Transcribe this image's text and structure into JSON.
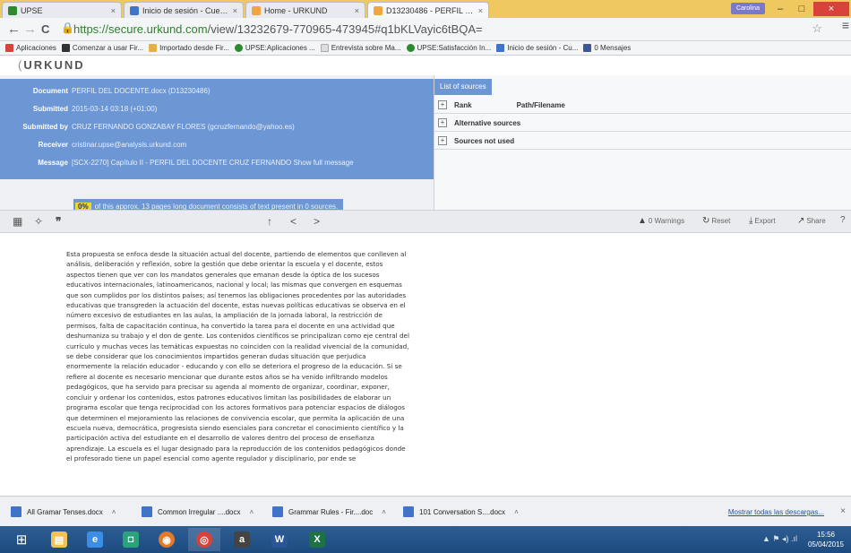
{
  "browser": {
    "tabs": [
      {
        "label": "UPSE",
        "active": false
      },
      {
        "label": "Inicio de sesión - Cuentas",
        "active": false
      },
      {
        "label": "Home - URKUND",
        "active": false
      },
      {
        "label": "D13230486 - PERFIL DEL",
        "active": true
      }
    ],
    "user_badge": "Carolina",
    "minimize": "–",
    "maximize": "□",
    "close": "×",
    "url_host": "https://secure.urkund.com",
    "url_path": "/view/13232679-770965-473945#q1bKLVayic6tBQA=",
    "back": "←",
    "forward": "→",
    "reload": "C",
    "star": "☆",
    "menu": "≡",
    "bookmarks": [
      {
        "label": "Aplicaciones",
        "color": "#d6453d"
      },
      {
        "label": "Comenzar a usar Fir...",
        "color": "#333333"
      },
      {
        "label": "Importado desde Fir...",
        "color": "#e2b24a"
      },
      {
        "label": "UPSE:Aplicaciones ...",
        "color": "#2f8a2f"
      },
      {
        "label": "Entrevista sobre Ma...",
        "color": "#cccccc"
      },
      {
        "label": "UPSE:Satisfacción In...",
        "color": "#2f8a2f"
      },
      {
        "label": "Inicio de sesión - Cu...",
        "color": "#3f74c9"
      },
      {
        "label": "0 Mensajes",
        "color": "#3b5998"
      }
    ]
  },
  "urkund": {
    "logo": "URKUND",
    "doc_info": [
      {
        "key": "Document",
        "value": "PERFIL DEL DOCENTE.docx (D13230486)"
      },
      {
        "key": "Submitted",
        "value": "2015-03-14 03:18 (+01:00)"
      },
      {
        "key": "Submitted by",
        "value": "CRUZ FERNANDO GONZABAY FLORES (gcruzfernando@yahoo.es)"
      },
      {
        "key": "Receiver",
        "value": "cristinar.upse@analysis.urkund.com"
      },
      {
        "key": "Message",
        "value": "[SCX-2270] Capítulo II - PERFIL DEL DOCENTE CRUZ FERNANDO  Show full message"
      }
    ],
    "match_pct": "0%",
    "match_text": "of this approx. 13 pages long document consists of text present in 0 sources.",
    "sources_tab": "List of sources",
    "sources_rows": [
      {
        "c1": "Rank",
        "c2": "Path/Filename"
      },
      {
        "c1": "Alternative sources",
        "c2": ""
      },
      {
        "c1": "Sources not used",
        "c2": ""
      }
    ],
    "toolbar": {
      "icon1": "▦",
      "icon2": "✧",
      "icon3": "❞",
      "up": "↑",
      "prev": "<",
      "next": ">",
      "warnings": "0 Warnings",
      "reset": "Reset",
      "export": "Export",
      "share": "Share",
      "warnings_icon": "▲",
      "reset_icon": "↻",
      "export_icon": "⤓",
      "share_icon": "↗",
      "help_icon": "?"
    },
    "document_text": "Esta propuesta se enfoca desde la situación actual del docente, partiendo de elementos que conlleven al análisis, deliberación y reflexión, sobre la gestión que debe orientar la escuela y el docente, estos aspectos tienen que ver con los mandatos generales que emanan desde la óptica de los sucesos educativos internacionales, latinoamericanos, nacional y local; las mismas que convergen en esquemas que son cumplidos por los distintos países; así tenemos las obligaciones procedentes por las autoridades educativas que transgreden la actuación del docente, estas nuevas políticas educativas se observa en el número excesivo de estudiantes en las aulas, la ampliación de la jornada laboral, la restricción de permisos, falta de capacitación continua, ha convertido la tarea para el docente en una actividad que deshumaniza su trabajo y el don de gente. Los contenidos científicos se principalizan como eje central del currículo y muchas veces las temáticas expuestas no coinciden con la realidad vivencial de la comunidad, se debe considerar que los conocimientos impartidos generan dudas situación que perjudica enormemente la relación educador - educando y con ello se deteriora el progreso de la educación. Si se refiere al docente es necesario mencionar que durante estos años se ha venido infiltrando modelos pedagógicos, que ha servido para precisar su agenda al momento de organizar, coordinar, exponer, concluir y ordenar los contenidos, estos patrones educativos limitan las posibilidades de elaborar un programa escolar que tenga reciprocidad con los actores formativos para potenciar espacios de diálogos que determinen el mejoramiento las relaciones de convivencia escolar, que permita la aplicación de una escuela nueva, democrática, progresista siendo esenciales para concretar el conocimiento científico y la participación activa del estudiante en el desarrollo de valores dentro del proceso de enseñanza aprendizaje. La escuela es el lugar designado para la reproducción de los contenidos pedagógicos donde el profesorado tiene un papel esencial como agente regulador y disciplinario, por ende se"
  },
  "downloads": {
    "items": [
      {
        "label": "All Gramar Tenses.docx"
      },
      {
        "label": "Common Irregular ....docx"
      },
      {
        "label": "Grammar Rules - Fir....doc"
      },
      {
        "label": "101 Conversation S....docx"
      }
    ],
    "show_all": "Mostrar todas las descargas...",
    "close": "×"
  },
  "taskbar": {
    "start": "⊞",
    "apps": [
      {
        "name": "explorer",
        "glyph": "▤",
        "color": "#f1c25b"
      },
      {
        "name": "ie",
        "glyph": "e",
        "color": "#3a8ee6"
      },
      {
        "name": "store",
        "glyph": "◘",
        "color": "#2aa27a"
      },
      {
        "name": "firefox",
        "glyph": "◉",
        "color": "#e27a2a"
      },
      {
        "name": "chrome",
        "glyph": "◎",
        "color": "#d9423a"
      },
      {
        "name": "amazon",
        "glyph": "a",
        "color": "#444444"
      },
      {
        "name": "word",
        "glyph": "W",
        "color": "#2b5797"
      },
      {
        "name": "excel",
        "glyph": "X",
        "color": "#1e7145"
      }
    ],
    "time": "15:56",
    "date": "05/04/2015",
    "tray": "▲  ⚑  ◂)  .ıl"
  }
}
